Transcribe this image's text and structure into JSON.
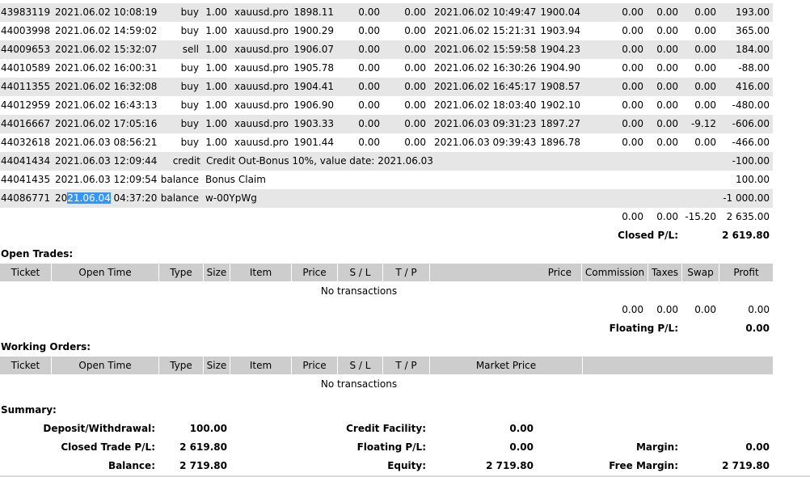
{
  "closed_trades": {
    "rows": [
      {
        "ticket": "43983119",
        "open_time": "2021.06.02 10:08:19",
        "type": "buy",
        "size": "1.00",
        "item": "xauusd.pro",
        "price": "1898.11",
        "sl": "0.00",
        "tp": "0.00",
        "close_time": "2021.06.02 10:49:47",
        "close_price": "1900.04",
        "commission": "0.00",
        "taxes": "0.00",
        "swap": "0.00",
        "profit": "193.00"
      },
      {
        "ticket": "44003998",
        "open_time": "2021.06.02 14:59:02",
        "type": "buy",
        "size": "1.00",
        "item": "xauusd.pro",
        "price": "1900.29",
        "sl": "0.00",
        "tp": "0.00",
        "close_time": "2021.06.02 15:21:31",
        "close_price": "1903.94",
        "commission": "0.00",
        "taxes": "0.00",
        "swap": "0.00",
        "profit": "365.00"
      },
      {
        "ticket": "44009653",
        "open_time": "2021.06.02 15:32:07",
        "type": "sell",
        "size": "1.00",
        "item": "xauusd.pro",
        "price": "1906.07",
        "sl": "0.00",
        "tp": "0.00",
        "close_time": "2021.06.02 15:59:58",
        "close_price": "1904.23",
        "commission": "0.00",
        "taxes": "0.00",
        "swap": "0.00",
        "profit": "184.00"
      },
      {
        "ticket": "44010589",
        "open_time": "2021.06.02 16:00:31",
        "type": "buy",
        "size": "1.00",
        "item": "xauusd.pro",
        "price": "1905.78",
        "sl": "0.00",
        "tp": "0.00",
        "close_time": "2021.06.02 16:30:26",
        "close_price": "1904.90",
        "commission": "0.00",
        "taxes": "0.00",
        "swap": "0.00",
        "profit": "-88.00"
      },
      {
        "ticket": "44011355",
        "open_time": "2021.06.02 16:32:08",
        "type": "buy",
        "size": "1.00",
        "item": "xauusd.pro",
        "price": "1904.41",
        "sl": "0.00",
        "tp": "0.00",
        "close_time": "2021.06.02 16:45:17",
        "close_price": "1908.57",
        "commission": "0.00",
        "taxes": "0.00",
        "swap": "0.00",
        "profit": "416.00"
      },
      {
        "ticket": "44012959",
        "open_time": "2021.06.02 16:43:13",
        "type": "buy",
        "size": "1.00",
        "item": "xauusd.pro",
        "price": "1906.90",
        "sl": "0.00",
        "tp": "0.00",
        "close_time": "2021.06.02 18:03:40",
        "close_price": "1902.10",
        "commission": "0.00",
        "taxes": "0.00",
        "swap": "0.00",
        "profit": "-480.00"
      },
      {
        "ticket": "44016667",
        "open_time": "2021.06.02 17:05:16",
        "type": "buy",
        "size": "1.00",
        "item": "xauusd.pro",
        "price": "1903.33",
        "sl": "0.00",
        "tp": "0.00",
        "close_time": "2021.06.03 09:31:23",
        "close_price": "1897.27",
        "commission": "0.00",
        "taxes": "0.00",
        "swap": "-9.12",
        "profit": "-606.00"
      },
      {
        "ticket": "44032618",
        "open_time": "2021.06.03 08:56:21",
        "type": "buy",
        "size": "1.00",
        "item": "xauusd.pro",
        "price": "1901.44",
        "sl": "0.00",
        "tp": "0.00",
        "close_time": "2021.06.03 09:39:43",
        "close_price": "1896.78",
        "commission": "0.00",
        "taxes": "0.00",
        "swap": "0.00",
        "profit": "-466.00"
      }
    ],
    "balance_rows": [
      {
        "ticket": "44041434",
        "time": "2021.06.03 12:09:44",
        "type": "credit",
        "comment": "Credit Out-Bonus 10%, value date: 2021.06.03",
        "profit": "-100.00"
      },
      {
        "ticket": "44041435",
        "time": "2021.06.03 12:09:54",
        "type": "balance",
        "comment": "Bonus Claim",
        "profit": "100.00"
      },
      {
        "ticket": "44086771",
        "time_pre": "20",
        "time_sel": "21.06.04",
        "time_post": " 04:37:20",
        "type": "balance",
        "comment": "w-00YpWg",
        "profit": "-1 000.00"
      }
    ],
    "totals": {
      "commission": "0.00",
      "taxes": "0.00",
      "swap": "-15.20",
      "profit": "2 635.00"
    },
    "closed_pl_label": "Closed P/L:",
    "closed_pl_value": "2 619.80"
  },
  "open_trades": {
    "title": "Open Trades:",
    "headers": {
      "ticket": "Ticket",
      "open_time": "Open Time",
      "type": "Type",
      "size": "Size",
      "item": "Item",
      "price": "Price",
      "sl": "S / L",
      "tp": "T / P",
      "price2": "Price",
      "commission": "Commission",
      "taxes": "Taxes",
      "swap": "Swap",
      "profit": "Profit"
    },
    "empty": "No transactions",
    "totals": {
      "commission": "0.00",
      "taxes": "0.00",
      "swap": "0.00",
      "profit": "0.00"
    },
    "floating_label": "Floating P/L:",
    "floating_value": "0.00"
  },
  "working_orders": {
    "title": "Working Orders:",
    "headers": {
      "ticket": "Ticket",
      "open_time": "Open Time",
      "type": "Type",
      "size": "Size",
      "item": "Item",
      "price": "Price",
      "sl": "S / L",
      "tp": "T / P",
      "market_price": "Market Price"
    },
    "empty": "No transactions"
  },
  "summary": {
    "title": "Summary:",
    "deposit_label": "Deposit/Withdrawal:",
    "deposit_value": "100.00",
    "closed_label": "Closed Trade P/L:",
    "closed_value": "2 619.80",
    "balance_label": "Balance:",
    "balance_value": "2 719.80",
    "credit_label": "Credit Facility:",
    "credit_value": "0.00",
    "floating_label": "Floating P/L:",
    "floating_value": "0.00",
    "equity_label": "Equity:",
    "equity_value": "2 719.80",
    "margin_label": "Margin:",
    "margin_value": "0.00",
    "free_margin_label": "Free Margin:",
    "free_margin_value": "2 719.80"
  }
}
